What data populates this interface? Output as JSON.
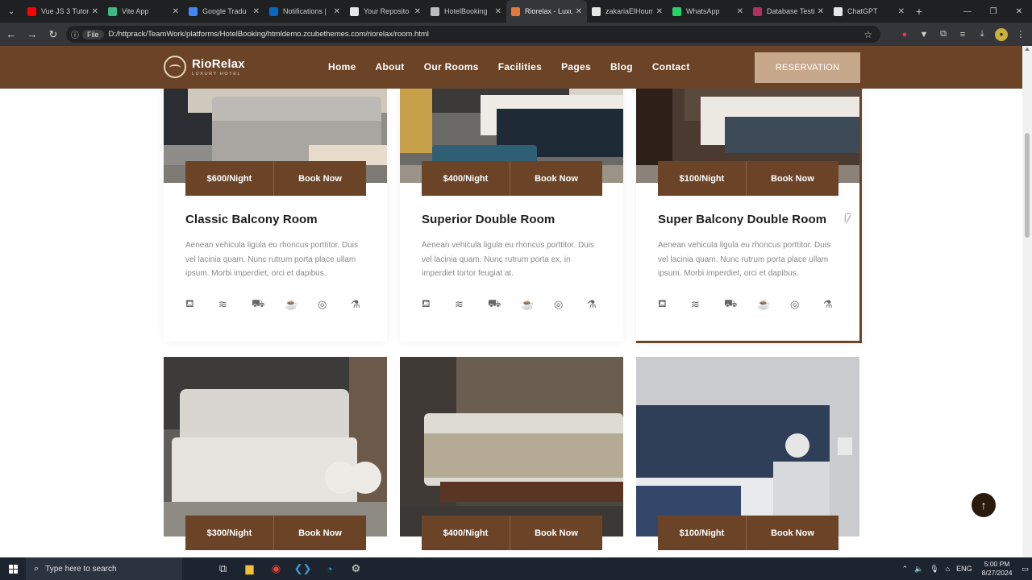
{
  "browser": {
    "tabs": [
      {
        "title": "Vue JS 3 Tutori",
        "color": "#ff0000"
      },
      {
        "title": "Vite App",
        "color": "#41b883"
      },
      {
        "title": "Google Tradu",
        "color": "#4285f4"
      },
      {
        "title": "Notifications |",
        "color": "#0a66c2"
      },
      {
        "title": "Your Reposito",
        "color": "#e6e6e6"
      },
      {
        "title": "HotelBooking",
        "color": "#bbbbbb"
      },
      {
        "title": "Riorelax - Luxu",
        "color": "#e27a3f"
      },
      {
        "title": "zakariaElHoum",
        "color": "#e6e6e6"
      },
      {
        "title": "WhatsApp",
        "color": "#25d366"
      },
      {
        "title": "Database Testi",
        "color": "#b03060"
      },
      {
        "title": "ChatGPT",
        "color": "#e6e6e6"
      }
    ],
    "active_tab": 6,
    "url_scheme": "File",
    "url": "D:/httprack/TeamWork/platforms/HotelBooking/htmldemo.zcubethemes.com/riorelax/room.html"
  },
  "site": {
    "logo_name": "RioRelax",
    "logo_sub": "LUXURY HOTEL",
    "nav": [
      "Home",
      "About",
      "Our Rooms",
      "Facilities",
      "Pages",
      "Blog",
      "Contact"
    ],
    "reservation_label": "RESERVATION"
  },
  "rooms": [
    {
      "price": "$600/Night",
      "book": "Book Now",
      "title": "Classic Balcony Room",
      "desc": "Aenean vehicula ligula eu rhoncus porttitor. Duis vel lacinia quam. Nunc rutrum porta place ullam ipsum. Morbi imperdiet, orci et dapibus."
    },
    {
      "price": "$400/Night",
      "book": "Book Now",
      "title": "Superior Double Room",
      "desc": "Aenean vehicula ligula eu rhoncus porttitor. Duis vel lacinia quam. Nunc rutrum porta ex, in imperdiet tortor feugiat at."
    },
    {
      "price": "$100/Night",
      "book": "Book Now",
      "title": "Super Balcony Double Room",
      "desc": "Aenean vehicula ligula eu rhoncus porttitor. Duis vel lacinia quam. Nunc rutrum porta place ullam ipsum. Morbi imperdiet, orci et dapibus."
    },
    {
      "price": "$300/Night",
      "book": "Book Now"
    },
    {
      "price": "$400/Night",
      "book": "Book Now"
    },
    {
      "price": "$100/Night",
      "book": "Book Now"
    }
  ],
  "amenity_icons": [
    "bed-icon",
    "wifi-icon",
    "car-icon",
    "coffee-icon",
    "pool-icon",
    "bathtub-icon"
  ],
  "taskbar": {
    "search_placeholder": "Type here to search",
    "language": "ENG",
    "time": "5:00 PM",
    "date": "8/27/2024"
  },
  "colors": {
    "brand": "#6b4428",
    "accent": "#c8a88b"
  }
}
